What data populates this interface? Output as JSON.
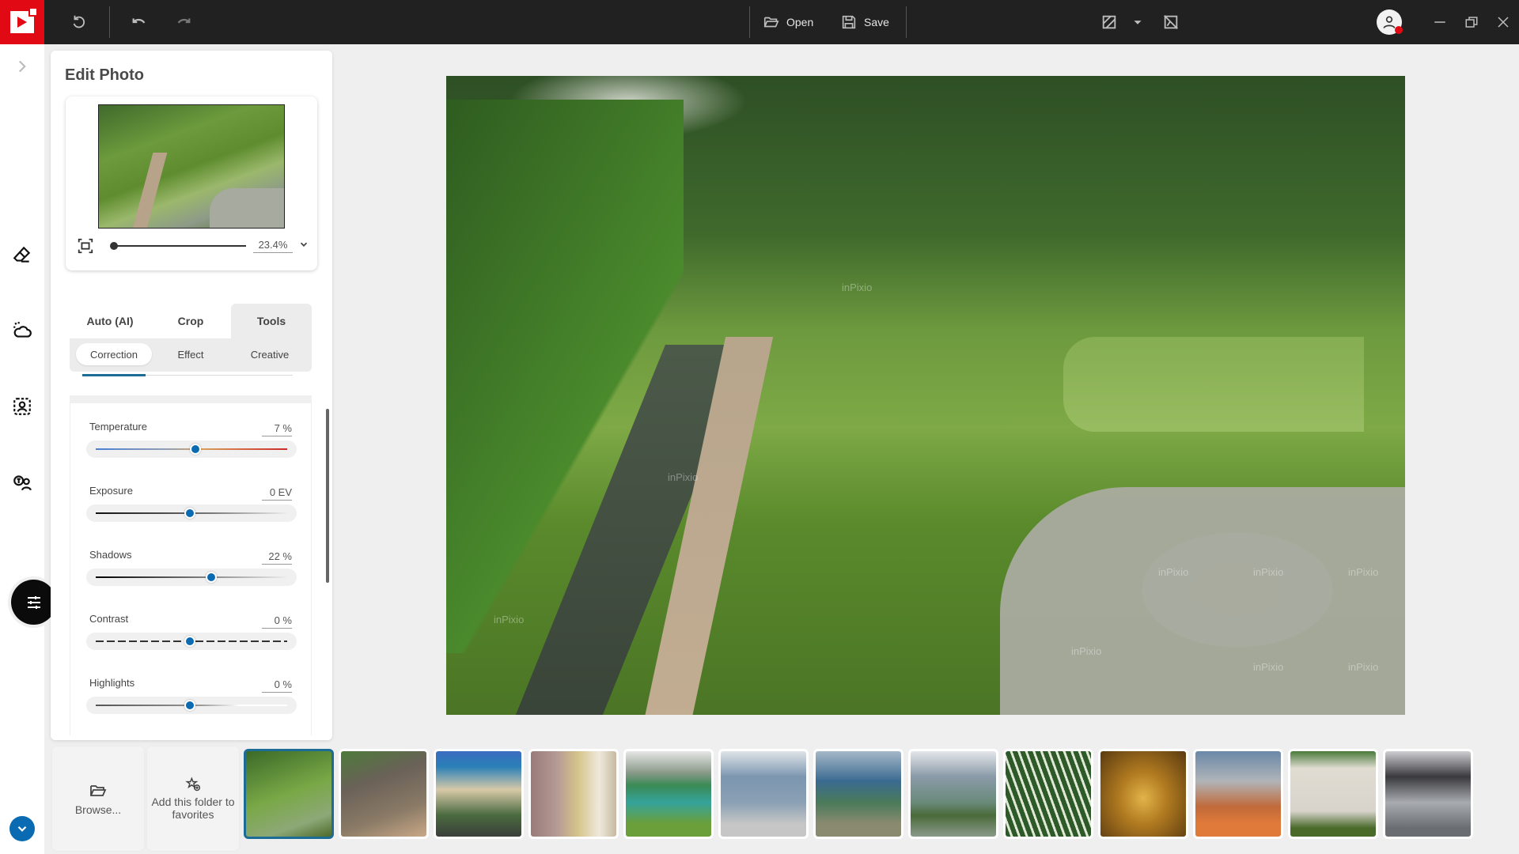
{
  "app": {
    "brand_color": "#e10a14",
    "accent_color": "#0a6bb3",
    "toolbar": {
      "open_label": "Open",
      "save_label": "Save",
      "icons": [
        "reset-icon",
        "undo-icon",
        "redo-icon",
        "open-folder-icon",
        "save-icon",
        "compare-icon",
        "chevron-down-icon",
        "hide-mask-icon",
        "user-avatar-icon",
        "minimize-icon",
        "restore-icon",
        "close-icon"
      ]
    }
  },
  "rail": {
    "items": [
      {
        "name": "expand",
        "icon": "chevron-right-icon"
      },
      {
        "name": "eraser",
        "icon": "eraser-icon"
      },
      {
        "name": "sky",
        "icon": "sky-replace-icon"
      },
      {
        "name": "portrait",
        "icon": "portrait-select-icon"
      },
      {
        "name": "text-people",
        "icon": "text-person-icon"
      },
      {
        "name": "adjustments",
        "icon": "sliders-icon",
        "active": true
      }
    ],
    "bottom": {
      "icon": "chevron-down-icon"
    }
  },
  "panel": {
    "title": "Edit Photo",
    "zoom_value": "23.4%",
    "zoom_fraction": 0.0,
    "tabs": [
      {
        "label": "Auto (AI)",
        "active": false
      },
      {
        "label": "Crop",
        "active": false
      },
      {
        "label": "Tools",
        "active": true
      }
    ],
    "subtabs": [
      {
        "label": "Correction",
        "active": true
      },
      {
        "label": "Effect",
        "active": false
      },
      {
        "label": "Creative",
        "active": false
      }
    ],
    "sliders": [
      {
        "label": "Temperature",
        "value": "7 %",
        "position": 0.53
      },
      {
        "label": "Exposure",
        "value": "0 EV",
        "position": 0.5
      },
      {
        "label": "Shadows",
        "value": "22 %",
        "position": 0.61
      },
      {
        "label": "Contrast",
        "value": "0 %",
        "position": 0.5
      },
      {
        "label": "Highlights",
        "value": "0 %",
        "position": 0.5
      }
    ]
  },
  "photo": {
    "watermark": "inPixio"
  },
  "filmstrip": {
    "browse_label": "Browse...",
    "favorites_label": "Add this folder to favorites",
    "thumbnails": [
      {
        "subject": "rice terraces",
        "selected": true
      },
      {
        "subject": "elephant",
        "selected": false
      },
      {
        "subject": "beach cove",
        "selected": false
      },
      {
        "subject": "church interior",
        "selected": false
      },
      {
        "subject": "mountain lake",
        "selected": false
      },
      {
        "subject": "footbridge",
        "selected": false
      },
      {
        "subject": "bay view",
        "selected": false
      },
      {
        "subject": "city skyline",
        "selected": false
      },
      {
        "subject": "striped plant",
        "selected": false
      },
      {
        "subject": "golden statue",
        "selected": false
      },
      {
        "subject": "street food",
        "selected": false
      },
      {
        "subject": "war graves",
        "selected": false
      },
      {
        "subject": "camper van",
        "selected": false
      }
    ]
  }
}
